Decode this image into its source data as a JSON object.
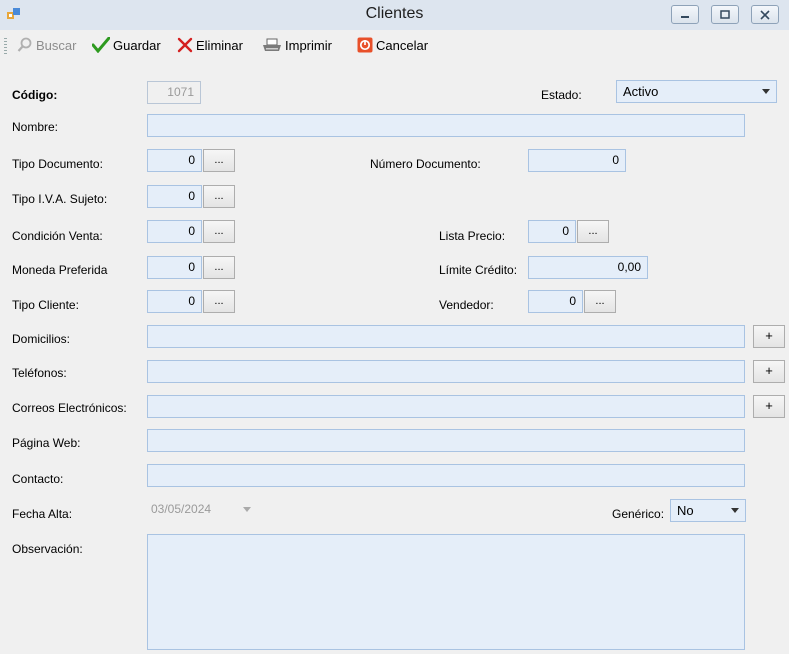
{
  "window": {
    "title": "Clientes"
  },
  "toolbar": {
    "buscar": "Buscar",
    "guardar": "Guardar",
    "eliminar": "Eliminar",
    "imprimir": "Imprimir",
    "cancelar": "Cancelar"
  },
  "form": {
    "codigo": {
      "label": "Código:",
      "value": "1071"
    },
    "estado": {
      "label": "Estado:",
      "value": "Activo"
    },
    "nombre": {
      "label": "Nombre:",
      "value": ""
    },
    "tipo_documento": {
      "label": "Tipo Documento:",
      "value": "0",
      "lookup": "..."
    },
    "numero_documento": {
      "label": "Número Documento:",
      "value": "0"
    },
    "tipo_iva": {
      "label": "Tipo I.V.A. Sujeto:",
      "value": "0",
      "lookup": "..."
    },
    "condicion_venta": {
      "label": "Condición Venta:",
      "value": "0",
      "lookup": "..."
    },
    "lista_precio": {
      "label": "Lista Precio:",
      "value": "0",
      "lookup": "..."
    },
    "moneda_preferida": {
      "label": "Moneda Preferida",
      "value": "0",
      "lookup": "..."
    },
    "limite_credito": {
      "label": "Límite Crédito:",
      "value": "0,00"
    },
    "tipo_cliente": {
      "label": "Tipo Cliente:",
      "value": "0",
      "lookup": "..."
    },
    "vendedor": {
      "label": "Vendedor:",
      "value": "0",
      "lookup": "..."
    },
    "domicilios": {
      "label": "Domicilios:",
      "value": "",
      "add": "+"
    },
    "telefonos": {
      "label": "Teléfonos:",
      "value": "",
      "add": "+"
    },
    "correos": {
      "label": "Correos Electrónicos:",
      "value": "",
      "add": "+"
    },
    "pagina_web": {
      "label": "Página Web:",
      "value": ""
    },
    "contacto": {
      "label": "Contacto:",
      "value": ""
    },
    "fecha_alta": {
      "label": "Fecha Alta:",
      "value": "03/05/2024"
    },
    "generico": {
      "label": "Genérico:",
      "value": "No"
    },
    "observacion": {
      "label": "Observación:",
      "value": ""
    }
  },
  "icons": {
    "app": "app-form-icon",
    "buscar": "search-icon",
    "guardar": "checkmark-icon",
    "eliminar": "x-delete-icon",
    "imprimir": "printer-icon",
    "cancelar": "cancel-icon"
  },
  "colors": {
    "field_bg": "#e5eef9",
    "field_border": "#a9c3e2",
    "check": "#2e9a1f",
    "delete": "#d42020",
    "cancel": "#e8502a"
  }
}
